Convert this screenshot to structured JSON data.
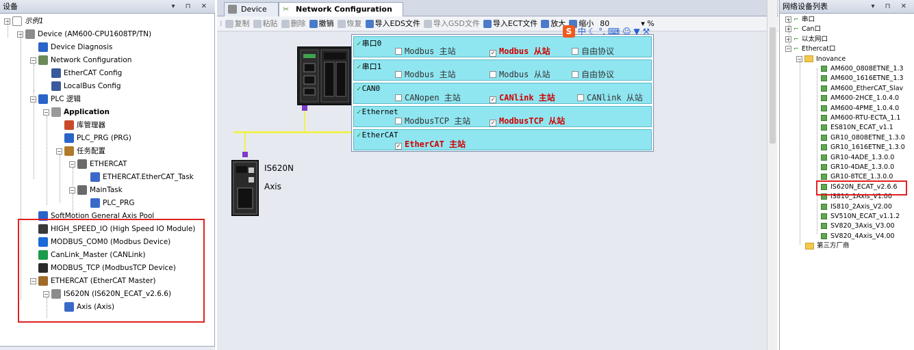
{
  "left_panel": {
    "title": "设备",
    "tree": [
      {
        "label": "示例1",
        "depth": 0
      },
      {
        "label": "Device (AM600-CPU1608TP/TN)",
        "depth": 1
      },
      {
        "label": "Device Diagnosis",
        "depth": 2
      },
      {
        "label": "Network Configuration",
        "depth": 2
      },
      {
        "label": "EtherCAT Config",
        "depth": 3
      },
      {
        "label": "LocalBus Config",
        "depth": 3
      },
      {
        "label": "PLC 逻辑",
        "depth": 2
      },
      {
        "label": "Application",
        "depth": 3
      },
      {
        "label": "库管理器",
        "depth": 4
      },
      {
        "label": "PLC_PRG (PRG)",
        "depth": 4
      },
      {
        "label": "任务配置",
        "depth": 4
      },
      {
        "label": "ETHERCAT",
        "depth": 5
      },
      {
        "label": "ETHERCAT.EtherCAT_Task",
        "depth": 6
      },
      {
        "label": "MainTask",
        "depth": 5
      },
      {
        "label": "PLC_PRG",
        "depth": 6
      },
      {
        "label": "SoftMotion General Axis Pool",
        "depth": 2
      },
      {
        "label": "HIGH_SPEED_IO (High Speed IO Module)",
        "depth": 2
      },
      {
        "label": "MODBUS_COM0 (Modbus Device)",
        "depth": 2
      },
      {
        "label": "CanLink_Master (CANLink)",
        "depth": 2
      },
      {
        "label": "MODBUS_TCP (ModbusTCP Device)",
        "depth": 2
      },
      {
        "label": "ETHERCAT (EtherCAT Master)",
        "depth": 2
      },
      {
        "label": "IS620N (IS620N_ECAT_v2.6.6)",
        "depth": 3
      },
      {
        "label": "Axis (Axis)",
        "depth": 4
      }
    ]
  },
  "tabs": [
    {
      "label": "Device"
    },
    {
      "label": "Network Configuration"
    }
  ],
  "toolbar": [
    {
      "label": "复制",
      "enabled": false
    },
    {
      "label": "粘贴",
      "enabled": false
    },
    {
      "label": "删除",
      "enabled": false
    },
    {
      "label": "撤销",
      "enabled": true
    },
    {
      "label": "恢复",
      "enabled": false
    },
    {
      "label": "导入EDS文件",
      "enabled": true
    },
    {
      "label": "导入GSD文件",
      "enabled": false
    },
    {
      "label": "导入ECT文件",
      "enabled": true
    },
    {
      "label": "放大",
      "enabled": true
    },
    {
      "label": "缩小",
      "enabled": true
    }
  ],
  "zoom": {
    "value": "80",
    "unit": "%"
  },
  "ime_bar": "中",
  "devices": {
    "plc": "",
    "servo_name": "IS620N",
    "servo_sub": "Axis"
  },
  "protocols": [
    {
      "name": "串口0",
      "options": [
        {
          "label": "Modbus 主站",
          "checked": false
        },
        {
          "label": "Modbus 从站",
          "checked": true
        },
        {
          "label": "自由协议",
          "checked": false
        }
      ]
    },
    {
      "name": "串口1",
      "options": [
        {
          "label": "Modbus 主站",
          "checked": false
        },
        {
          "label": "Modbus 从站",
          "checked": false
        },
        {
          "label": "自由协议",
          "checked": false
        }
      ]
    },
    {
      "name": "CAN0",
      "options": [
        {
          "label": "CANopen 主站",
          "checked": false
        },
        {
          "label": "CANlink 主站",
          "checked": true
        },
        {
          "label": "CANlink 从站",
          "checked": false
        }
      ]
    },
    {
      "name": "Ethernet",
      "options": [
        {
          "label": "ModbusTCP 主站",
          "checked": false
        },
        {
          "label": "ModbusTCP 从站",
          "checked": true
        }
      ]
    },
    {
      "name": "EtherCAT",
      "options": [
        {
          "label": "EtherCAT 主站",
          "checked": true
        }
      ]
    }
  ],
  "right_panel": {
    "title": "网络设备列表",
    "tree": [
      {
        "label": "串口",
        "depth": 0,
        "kind": "net"
      },
      {
        "label": "Can口",
        "depth": 0,
        "kind": "net"
      },
      {
        "label": "以太网口",
        "depth": 0,
        "kind": "net"
      },
      {
        "label": "Ethercat口",
        "depth": 0,
        "kind": "net"
      },
      {
        "label": "Inovance",
        "depth": 1,
        "kind": "folder"
      },
      {
        "label": "AM600_0808ETNE_1.3",
        "depth": 2,
        "kind": "dev"
      },
      {
        "label": "AM600_1616ETNE_1.3",
        "depth": 2,
        "kind": "dev"
      },
      {
        "label": "AM600_EtherCAT_Slav",
        "depth": 2,
        "kind": "dev"
      },
      {
        "label": "AM600-2HCE_1.0.4.0",
        "depth": 2,
        "kind": "dev"
      },
      {
        "label": "AM600-4PME_1.0.4.0",
        "depth": 2,
        "kind": "dev"
      },
      {
        "label": "AM600-RTU-ECTA_1.1",
        "depth": 2,
        "kind": "dev"
      },
      {
        "label": "ES810N_ECAT_v1.1",
        "depth": 2,
        "kind": "dev"
      },
      {
        "label": "GR10_0808ETNE_1.3.0",
        "depth": 2,
        "kind": "dev"
      },
      {
        "label": "GR10_1616ETNE_1.3.0",
        "depth": 2,
        "kind": "dev"
      },
      {
        "label": "GR10-4ADE_1.3.0.0",
        "depth": 2,
        "kind": "dev"
      },
      {
        "label": "GR10-4DAE_1.3.0.0",
        "depth": 2,
        "kind": "dev"
      },
      {
        "label": "GR10-8TCE_1.3.0.0",
        "depth": 2,
        "kind": "dev"
      },
      {
        "label": "IS620N_ECAT_v2.6.6",
        "depth": 2,
        "kind": "dev"
      },
      {
        "label": "IS810_1Axis_V1.00",
        "depth": 2,
        "kind": "dev"
      },
      {
        "label": "IS810_2Axis_V2.00",
        "depth": 2,
        "kind": "dev"
      },
      {
        "label": "SV510N_ECAT_v1.1.2",
        "depth": 2,
        "kind": "dev"
      },
      {
        "label": "SV820_3Axis_V3.00",
        "depth": 2,
        "kind": "dev"
      },
      {
        "label": "SV820_4Axis_V4.00",
        "depth": 2,
        "kind": "dev"
      },
      {
        "label": "第三方厂商",
        "depth": 1,
        "kind": "folder"
      }
    ]
  },
  "colors": {
    "highlight_box": "#e02020",
    "protocol_bg": "#8fe6f0",
    "bus": "#f0f050",
    "port": "#7d3cc8"
  }
}
